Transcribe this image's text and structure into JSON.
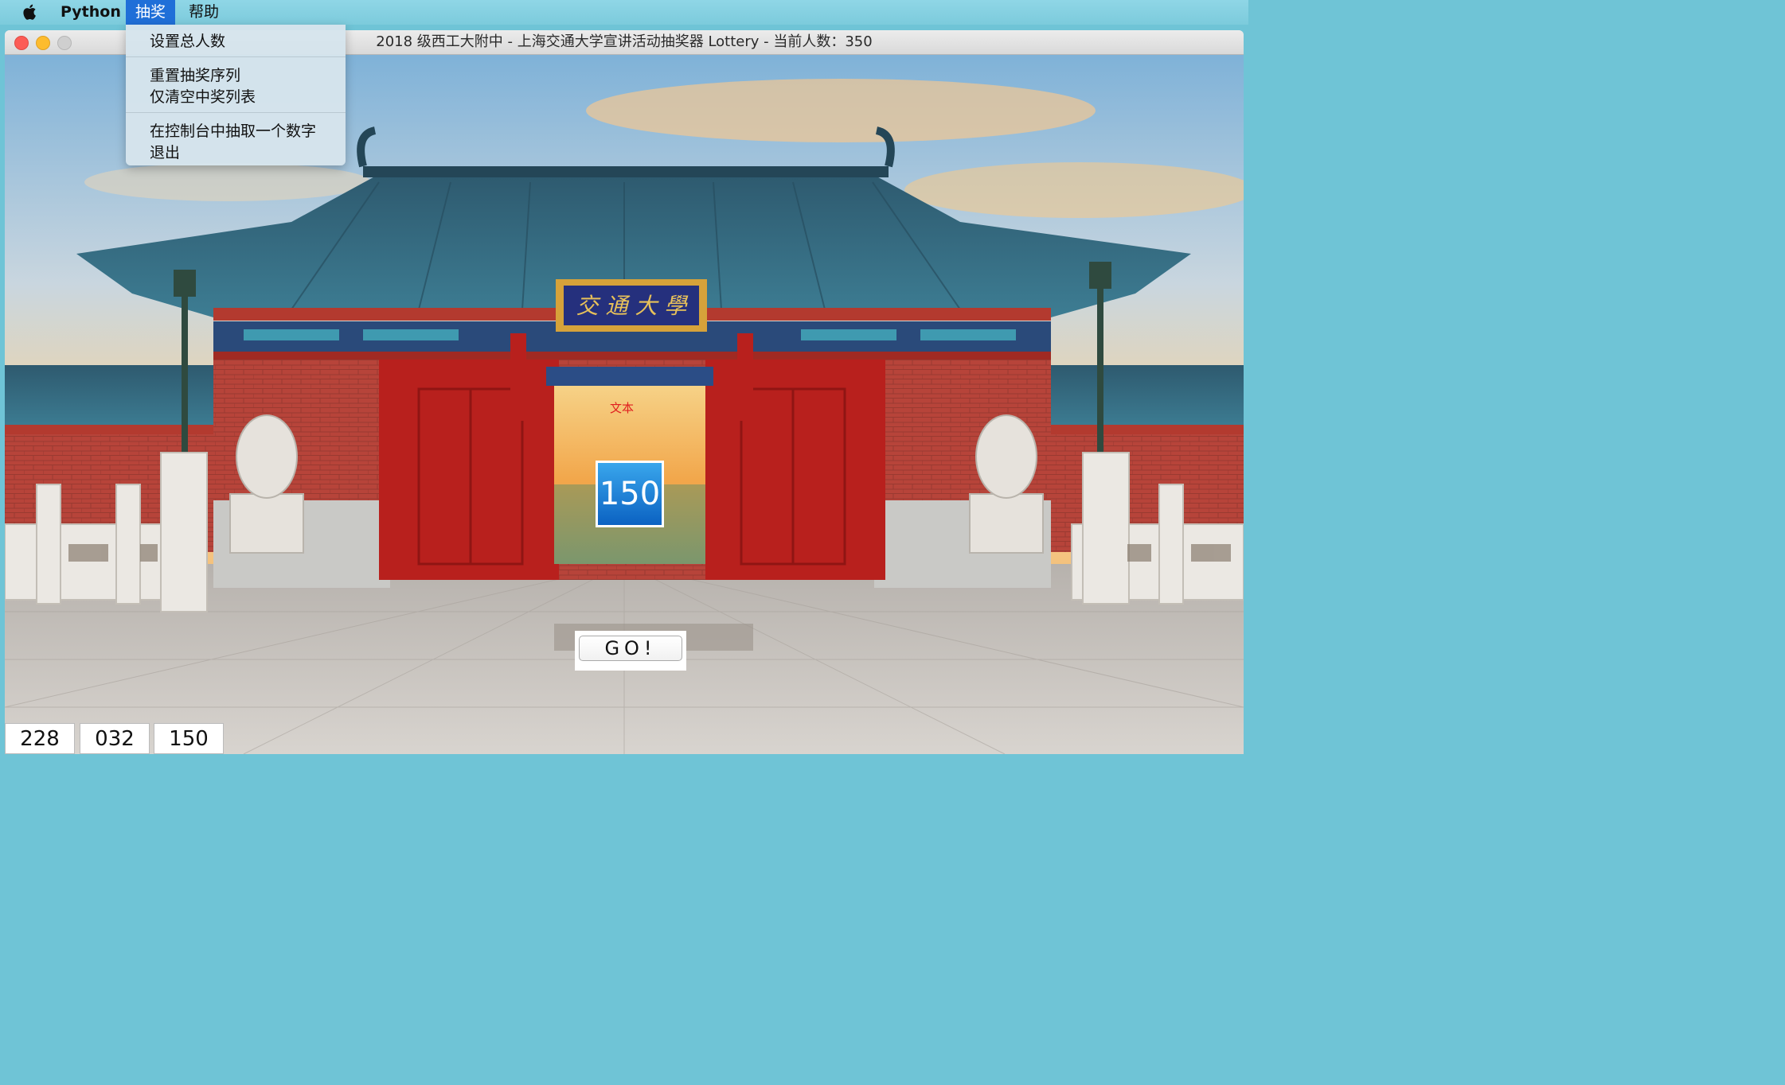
{
  "menubar": {
    "app_name": "Python",
    "menus": [
      "抽奖",
      "帮助"
    ],
    "active_menu": "抽奖"
  },
  "window": {
    "title": "2018 级西工大附中 - 上海交通大学宣讲活动抽奖器 Lottery - 当前人数：350"
  },
  "dropdown": {
    "items": [
      "设置总人数",
      "重置抽奖序列",
      "仅清空中奖列表",
      "在控制台中抽取一个数字",
      "退出"
    ]
  },
  "canvas": {
    "plaque_text": "交 通 大 學",
    "red_label": "文本",
    "current_number": "150",
    "go_label": "GO!",
    "winners": [
      "228",
      "032",
      "150"
    ]
  },
  "colors": {
    "active_menu": "#1f6fd8",
    "result_box": "#0b62c2",
    "close": "#fc5c56",
    "minimize": "#fdbc2e"
  }
}
